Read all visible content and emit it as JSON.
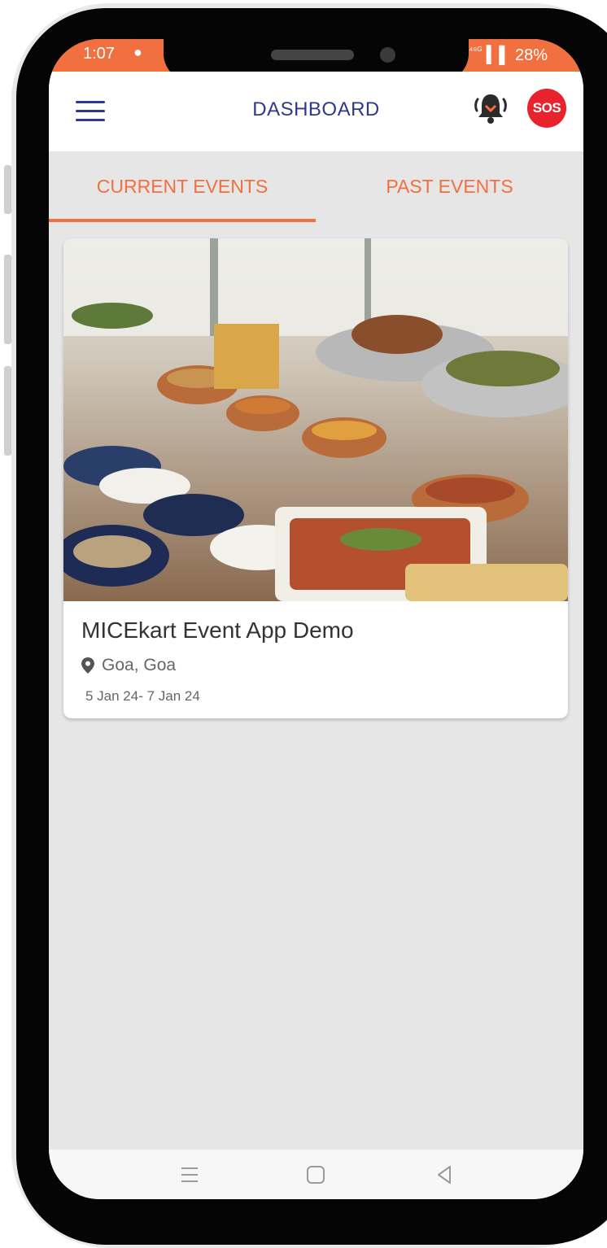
{
  "status_bar": {
    "time": "1:07",
    "network": "⁴⁶ᴳ",
    "battery": "28%"
  },
  "header": {
    "title": "DASHBOARD",
    "sos_label": "SOS"
  },
  "tabs": [
    {
      "label": "CURRENT EVENTS",
      "active": true
    },
    {
      "label": "PAST EVENTS",
      "active": false
    }
  ],
  "events": [
    {
      "title": "MICEkart Event App Demo",
      "location": "Goa, Goa",
      "dates": "5 Jan 24- 7 Jan 24"
    }
  ],
  "colors": {
    "accent": "#f2703f",
    "primary": "#2d3a8c",
    "sos": "#e8232d"
  },
  "icons": [
    "menu-icon",
    "bell-icon",
    "location-pin-icon",
    "nav-recents-icon",
    "nav-home-icon",
    "nav-back-icon"
  ]
}
